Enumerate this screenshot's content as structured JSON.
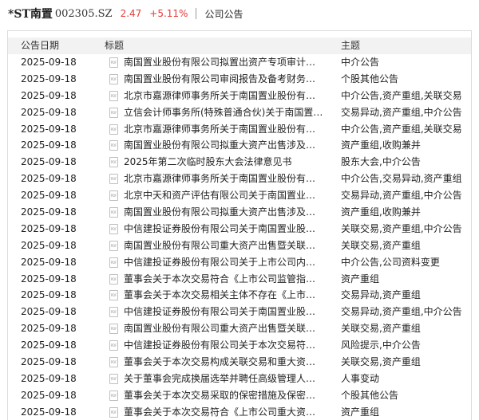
{
  "header": {
    "stock_name": "*ST南置",
    "stock_code": "002305.SZ",
    "price": "2.47",
    "change": "+5.11%",
    "section": "公司公告",
    "price_color": "#e23b36"
  },
  "table": {
    "columns": {
      "date": "公告日期",
      "title": "标题",
      "tags": "主题"
    },
    "icon": "pdf-file-icon",
    "icon_text": "PDF",
    "rows": [
      {
        "date": "2025-09-18",
        "title": "南国置业股份有限公司拟置出资产专项审计…",
        "tags": "中介公告"
      },
      {
        "date": "2025-09-18",
        "title": "南国置业股份有限公司审阅报告及备考财务…",
        "tags": "个股其他公告"
      },
      {
        "date": "2025-09-18",
        "title": "北京市嘉源律师事务所关于南国置业股份有…",
        "tags": "中介公告,资产重组,关联交易"
      },
      {
        "date": "2025-09-18",
        "title": "立信会计师事务所(特殊普通合伙)关于南国置…",
        "tags": "交易异动,资产重组,中介公告"
      },
      {
        "date": "2025-09-18",
        "title": "北京市嘉源律师事务所关于南国置业股份有…",
        "tags": "中介公告,资产重组,关联交易"
      },
      {
        "date": "2025-09-18",
        "title": "南国置业股份有限公司拟重大资产出售涉及…",
        "tags": "资产重组,收购兼并"
      },
      {
        "date": "2025-09-18",
        "title": "2025年第二次临时股东大会法律意见书",
        "tags": "股东大会,中介公告"
      },
      {
        "date": "2025-09-18",
        "title": "北京市嘉源律师事务所关于南国置业股份有…",
        "tags": "中介公告,交易异动,资产重组"
      },
      {
        "date": "2025-09-18",
        "title": "北京中天和资产评估有限公司关于南国置业…",
        "tags": "交易异动,资产重组,中介公告"
      },
      {
        "date": "2025-09-18",
        "title": "南国置业股份有限公司拟重大资产出售涉及…",
        "tags": "资产重组,收购兼并"
      },
      {
        "date": "2025-09-18",
        "title": "中信建投证券股份有限公司关于南国置业股…",
        "tags": "关联交易,资产重组,中介公告"
      },
      {
        "date": "2025-09-18",
        "title": "南国置业股份有限公司重大资产出售暨关联…",
        "tags": "关联交易,资产重组"
      },
      {
        "date": "2025-09-18",
        "title": "中信建投证券股份有限公司关于上市公司内…",
        "tags": "中介公告,公司资料变更"
      },
      {
        "date": "2025-09-18",
        "title": "董事会关于本次交易符合《上市公司监管指…",
        "tags": "资产重组"
      },
      {
        "date": "2025-09-18",
        "title": "董事会关于本次交易相关主体不存在《上市…",
        "tags": "交易异动,资产重组"
      },
      {
        "date": "2025-09-18",
        "title": "中信建投证券股份有限公司关于南国置业股…",
        "tags": "交易异动,资产重组,中介公告"
      },
      {
        "date": "2025-09-18",
        "title": "南国置业股份有限公司重大资产出售暨关联…",
        "tags": "关联交易,资产重组"
      },
      {
        "date": "2025-09-18",
        "title": "中信建投证券股份有限公司关于本次交易符…",
        "tags": "风险提示,中介公告"
      },
      {
        "date": "2025-09-18",
        "title": "董事会关于本次交易构成关联交易和重大资…",
        "tags": "关联交易,资产重组"
      },
      {
        "date": "2025-09-18",
        "title": "关于董事会完成换届选举并聘任高级管理人…",
        "tags": "人事变动"
      },
      {
        "date": "2025-09-18",
        "title": "董事会关于本次交易采取的保密措施及保密…",
        "tags": "个股其他公告"
      },
      {
        "date": "2025-09-18",
        "title": "董事会关于本次交易符合《上市公司重大资…",
        "tags": "资产重组"
      }
    ]
  }
}
